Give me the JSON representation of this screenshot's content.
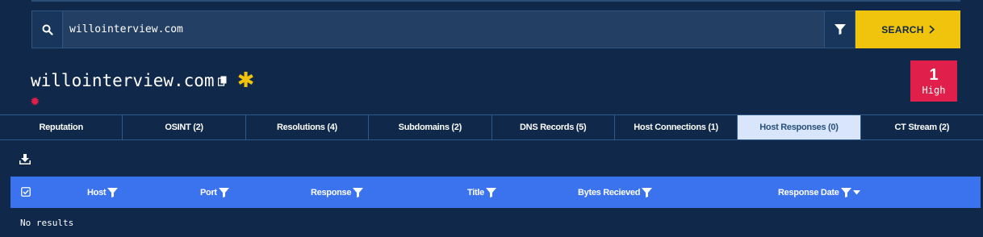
{
  "search": {
    "value": "willointerview.com",
    "button_label": "SEARCH"
  },
  "entity": {
    "domain": "willointerview.com",
    "risk_count": "1",
    "risk_level": "High"
  },
  "tabs": [
    {
      "label": "Reputation"
    },
    {
      "label": "OSINT (2)"
    },
    {
      "label": "Resolutions (4)"
    },
    {
      "label": "Subdomains (2)"
    },
    {
      "label": "DNS Records (5)"
    },
    {
      "label": "Host Connections (1)"
    },
    {
      "label": "Host Responses (0)",
      "active": true
    },
    {
      "label": "CT Stream (2)"
    }
  ],
  "table": {
    "columns": [
      "Host",
      "Port",
      "Response",
      "Title",
      "Bytes Recieved",
      "Response Date"
    ],
    "empty_text": "No results"
  },
  "colors": {
    "background": "#10284a",
    "accent_yellow": "#f0c40c",
    "risk_red": "#e0204a",
    "table_header_blue": "#3b72ee",
    "active_tab": "#d8e5fb"
  },
  "icons": [
    "search-icon",
    "filter-icon",
    "chevron-right-icon",
    "copy-icon",
    "star-icon",
    "gear-icon",
    "download-icon",
    "checkbox-icon",
    "filter-icon",
    "sort-down-icon"
  ]
}
